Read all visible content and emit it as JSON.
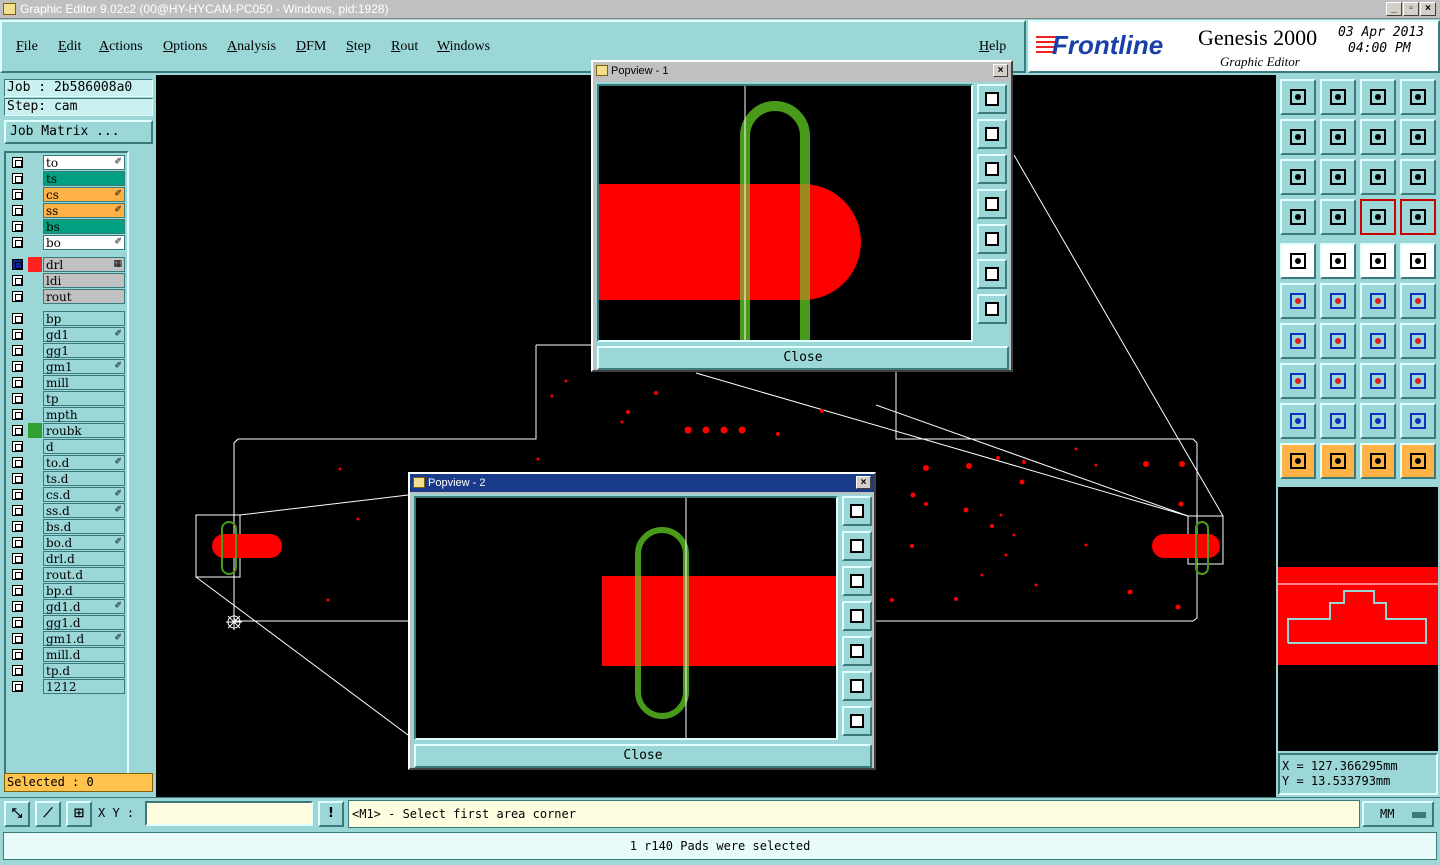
{
  "window": {
    "title": "Graphic Editor 9.02c2 (00@HY-HYCAM-PC050 - Windows, pid:1928)",
    "min": "_",
    "max": "▫",
    "close": "×"
  },
  "menu": {
    "file": "File",
    "edit": "Edit",
    "actions": "Actions",
    "options": "Options",
    "analysis": "Analysis",
    "dfm": "DFM",
    "step": "Step",
    "rout": "Rout",
    "windows": "Windows",
    "help": "Help"
  },
  "brand": {
    "logo": "Frontline",
    "product": "Genesis 2000",
    "subtitle": "Graphic Editor",
    "date": "03 Apr 2013",
    "time": "04:00 PM"
  },
  "job": {
    "job": "Job : 2b586008a0",
    "step": "Step: cam",
    "matrix": "Job Matrix ..."
  },
  "layers": [
    {
      "name": "to",
      "bg": "#ffffff",
      "flag": "✐"
    },
    {
      "name": "ts",
      "bg": "#00a080",
      "flag": ""
    },
    {
      "name": "cs",
      "bg": "#ffb347",
      "flag": "✐"
    },
    {
      "name": "ss",
      "bg": "#ffb347",
      "flag": "✐"
    },
    {
      "name": "bs",
      "bg": "#00a080",
      "flag": ""
    },
    {
      "name": "bo",
      "bg": "#ffffff",
      "flag": "✐"
    },
    {
      "name": "drl",
      "bg": "#c0c0c0",
      "flag": "▦",
      "swatch": "#ff2020",
      "cb": "#1020a0"
    },
    {
      "name": "ldi",
      "bg": "#c0c0c0",
      "flag": ""
    },
    {
      "name": "rout",
      "bg": "#c0c0c0",
      "flag": ""
    },
    {
      "name": "bp",
      "bg": "#9bd7d7",
      "flag": ""
    },
    {
      "name": "gd1",
      "bg": "#9bd7d7",
      "flag": "✐"
    },
    {
      "name": "gg1",
      "bg": "#9bd7d7",
      "flag": ""
    },
    {
      "name": "gm1",
      "bg": "#9bd7d7",
      "flag": "✐"
    },
    {
      "name": "mill",
      "bg": "#9bd7d7",
      "flag": ""
    },
    {
      "name": "tp",
      "bg": "#9bd7d7",
      "flag": ""
    },
    {
      "name": "mpth",
      "bg": "#9bd7d7",
      "flag": ""
    },
    {
      "name": "roubk",
      "bg": "#9bd7d7",
      "flag": "",
      "swatch": "#30a030"
    },
    {
      "name": "d",
      "bg": "#9bd7d7",
      "flag": ""
    },
    {
      "name": "to.d",
      "bg": "#9bd7d7",
      "flag": "✐"
    },
    {
      "name": "ts.d",
      "bg": "#9bd7d7",
      "flag": ""
    },
    {
      "name": "cs.d",
      "bg": "#9bd7d7",
      "flag": "✐"
    },
    {
      "name": "ss.d",
      "bg": "#9bd7d7",
      "flag": "✐"
    },
    {
      "name": "bs.d",
      "bg": "#9bd7d7",
      "flag": ""
    },
    {
      "name": "bo.d",
      "bg": "#9bd7d7",
      "flag": "✐"
    },
    {
      "name": "drl.d",
      "bg": "#9bd7d7",
      "flag": ""
    },
    {
      "name": "rout.d",
      "bg": "#9bd7d7",
      "flag": ""
    },
    {
      "name": "bp.d",
      "bg": "#9bd7d7",
      "flag": ""
    },
    {
      "name": "gd1.d",
      "bg": "#9bd7d7",
      "flag": "✐"
    },
    {
      "name": "gg1.d",
      "bg": "#9bd7d7",
      "flag": ""
    },
    {
      "name": "gm1.d",
      "bg": "#9bd7d7",
      "flag": "✐"
    },
    {
      "name": "mill.d",
      "bg": "#9bd7d7",
      "flag": ""
    },
    {
      "name": "tp.d",
      "bg": "#9bd7d7",
      "flag": ""
    },
    {
      "name": "1212",
      "bg": "#9bd7d7",
      "flag": ""
    }
  ],
  "selected": "Selected : 0",
  "popview1": {
    "title": "Popview - 1",
    "close": "Close"
  },
  "popview2": {
    "title": "Popview - 2",
    "close": "Close"
  },
  "coords": {
    "x": "X = 127.366295mm",
    "y": "Y = 13.533793mm"
  },
  "cmd": {
    "xy_label": "X Y :",
    "xy_value": "",
    "alert": "!",
    "prompt": "<M1> - Select first area corner",
    "units": "MM"
  },
  "status": "1 r140 Pads were selected",
  "colors": {
    "accent": "#9bd7d7",
    "copper": "#ff0000",
    "rout": "#4a9a1a",
    "background": "#000000"
  }
}
